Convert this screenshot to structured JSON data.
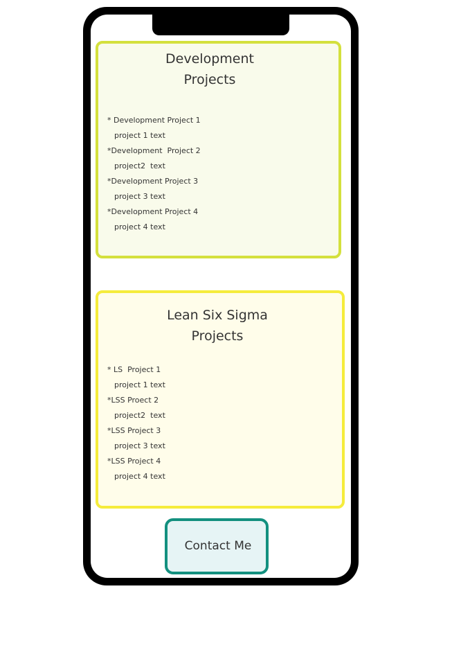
{
  "development": {
    "title": "Development Projects",
    "projects": [
      {
        "name": "* Development Project 1",
        "text": "project 1 text"
      },
      {
        "name": "*Development  Project 2",
        "text": "project2  text"
      },
      {
        "name": "*Development Project 3",
        "text": "project 3 text"
      },
      {
        "name": "*Development Project 4",
        "text": "project 4 text"
      }
    ]
  },
  "lean_six_sigma": {
    "title": "Lean Six Sigma Projects",
    "projects": [
      {
        "name": "* LS  Project 1",
        "text": "project 1 text"
      },
      {
        "name": "*LSS Proect 2",
        "text": "project2  text"
      },
      {
        "name": "*LSS Project 3",
        "text": "project 3 text"
      },
      {
        "name": "*LSS Project 4",
        "text": "project 4 text"
      }
    ]
  },
  "contact": {
    "label": "Contact Me"
  },
  "colors": {
    "phone_frame": "#000000",
    "development_border": "#d4e03d",
    "development_fill": "#f9fbeb",
    "lss_border": "#f5ec3c",
    "lss_fill": "#fffdea",
    "contact_border": "#13907f",
    "contact_fill": "#e6f4f5"
  }
}
